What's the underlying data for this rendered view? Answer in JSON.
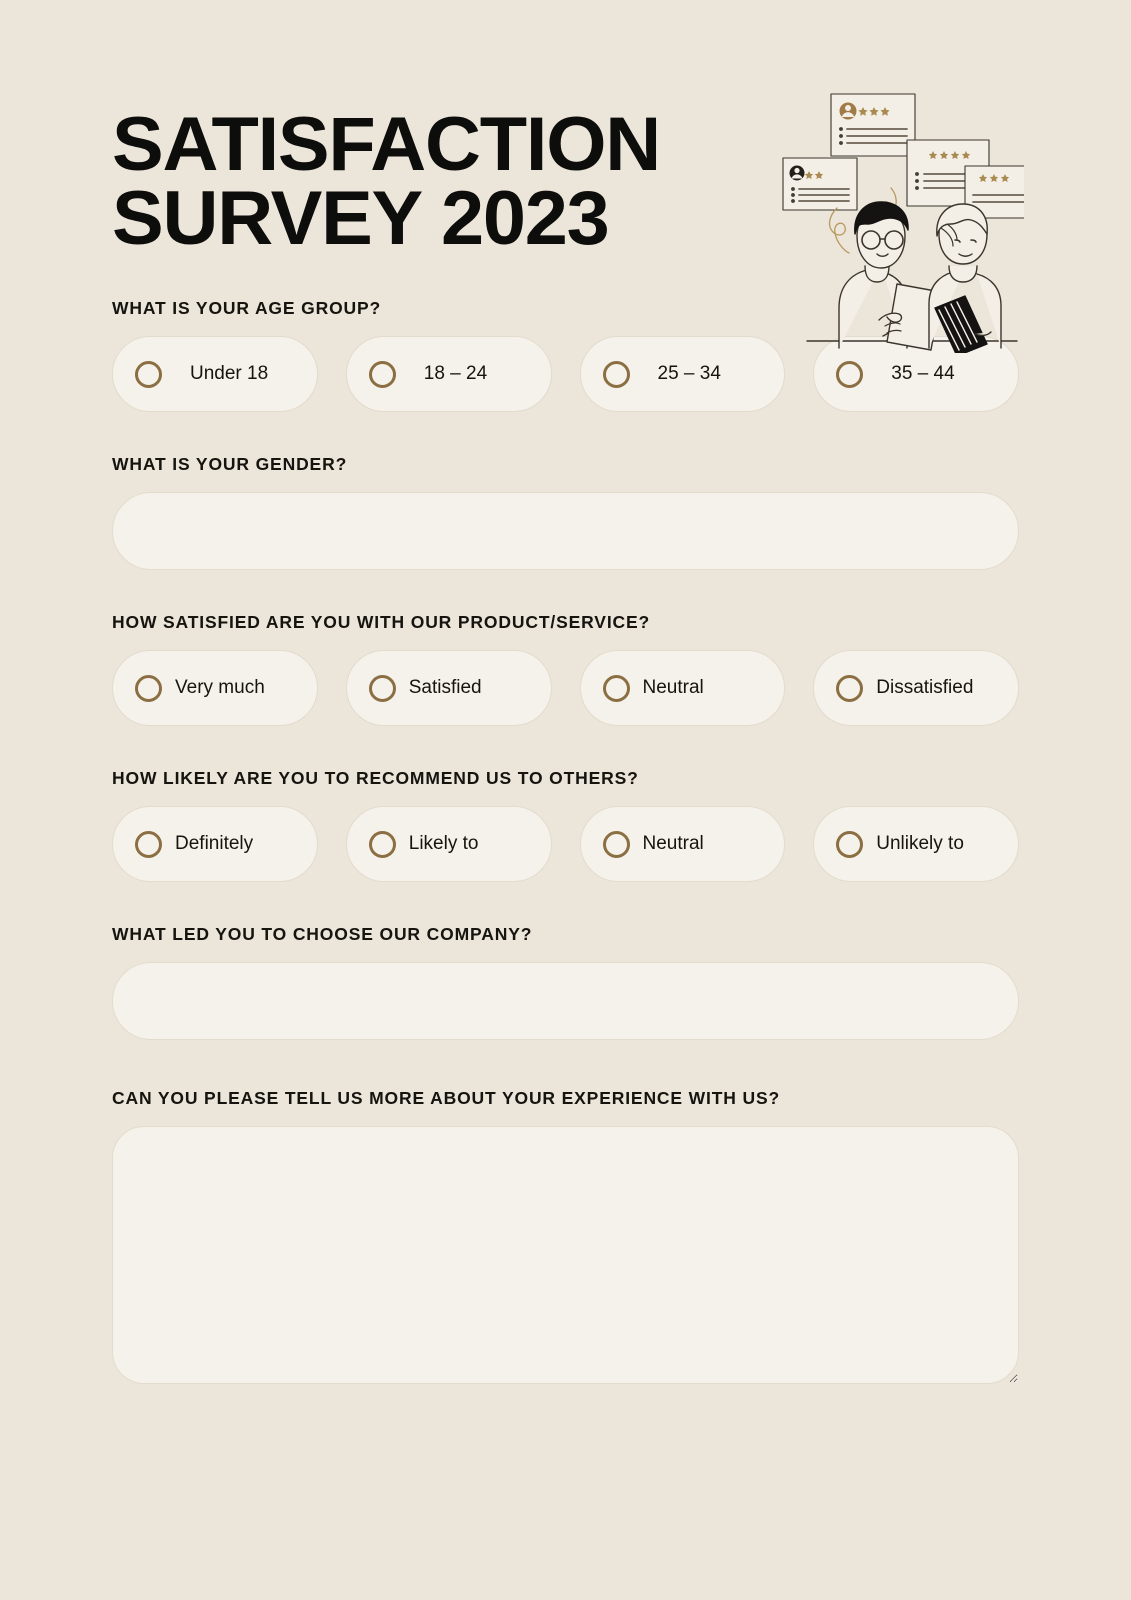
{
  "document": {
    "title_line_1": "SATISFACTION",
    "title_line_2": "SURVEY 2023"
  },
  "theme": {
    "background": "#ece5da",
    "field_fill": "#f5f2eb",
    "field_border": "#e3dbcd",
    "accent_brown": "#8b6f43",
    "text": "#15140f"
  },
  "illustration": {
    "name": "two-people-reading-reviews-illustration",
    "star_color": "#a98b52",
    "cards": [
      {
        "stars": 3,
        "avatar": true
      },
      {
        "stars": 2,
        "avatar": true
      },
      {
        "stars": 4,
        "avatar": false
      },
      {
        "stars": 3,
        "avatar": false
      }
    ]
  },
  "questions": [
    {
      "id": "age-group",
      "label": "WHAT IS YOUR AGE GROUP?",
      "type": "radio-row",
      "options": [
        "Under 18",
        "18 – 24",
        "25 – 34",
        "35 – 44"
      ]
    },
    {
      "id": "gender",
      "label": "WHAT IS YOUR GENDER?",
      "type": "text-input",
      "value": "",
      "placeholder": ""
    },
    {
      "id": "satisfaction",
      "label": "HOW SATISFIED ARE YOU WITH OUR PRODUCT/SERVICE?",
      "type": "radio-row",
      "options": [
        "Very much",
        "Satisfied",
        "Neutral",
        "Dissatisfied"
      ]
    },
    {
      "id": "recommend",
      "label": "HOW LIKELY ARE YOU TO RECOMMEND US TO OTHERS?",
      "type": "radio-row",
      "options": [
        "Definitely",
        "Likely to",
        "Neutral",
        "Unlikely to"
      ]
    },
    {
      "id": "choose-company",
      "label": "WHAT LED YOU TO CHOOSE OUR COMPANY?",
      "type": "text-input",
      "value": "",
      "placeholder": ""
    },
    {
      "id": "experience",
      "label": "CAN YOU PLEASE TELL US MORE ABOUT YOUR EXPERIENCE WITH US?",
      "type": "textarea",
      "value": "",
      "placeholder": ""
    }
  ]
}
